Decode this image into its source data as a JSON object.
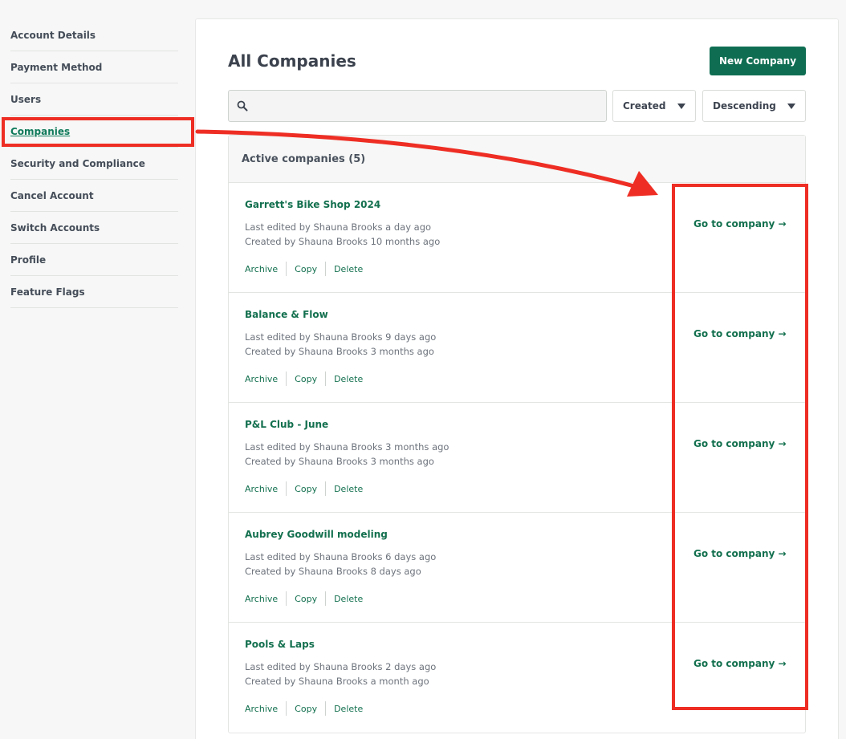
{
  "sidebar": {
    "items": [
      {
        "label": "Account Details"
      },
      {
        "label": "Payment Method"
      },
      {
        "label": "Users"
      },
      {
        "label": "Companies",
        "active": true
      },
      {
        "label": "Security and Compliance"
      },
      {
        "label": "Cancel Account"
      },
      {
        "label": "Switch Accounts"
      },
      {
        "label": "Profile"
      },
      {
        "label": "Feature Flags"
      }
    ]
  },
  "main": {
    "title": "All Companies",
    "new_button": "New Company",
    "search": {
      "value": "",
      "icon": "search-icon"
    },
    "sort_field": "Created",
    "sort_order": "Descending",
    "list_header": "Active companies (5)",
    "companies": [
      {
        "name": "Garrett's Bike Shop 2024",
        "edited": "Last edited by Shauna Brooks a day ago",
        "created": "Created by Shauna Brooks 10 months ago"
      },
      {
        "name": "Balance & Flow",
        "edited": "Last edited by Shauna Brooks 9 days ago",
        "created": "Created by Shauna Brooks 3 months ago"
      },
      {
        "name": "P&L Club - June",
        "edited": "Last edited by Shauna Brooks 3 months ago",
        "created": "Created by Shauna Brooks 3 months ago"
      },
      {
        "name": "Aubrey Goodwill modeling",
        "edited": "Last edited by Shauna Brooks 6 days ago",
        "created": "Created by Shauna Brooks 8 days ago"
      },
      {
        "name": "Pools & Laps",
        "edited": "Last edited by Shauna Brooks 2 days ago",
        "created": "Created by Shauna Brooks a month ago"
      }
    ],
    "actions": {
      "archive": "Archive",
      "copy": "Copy",
      "delete": "Delete"
    },
    "goto_label": "Go to company →"
  },
  "colors": {
    "accent": "#0f6e52",
    "link": "#13704f",
    "annotation": "#ee2e24"
  }
}
